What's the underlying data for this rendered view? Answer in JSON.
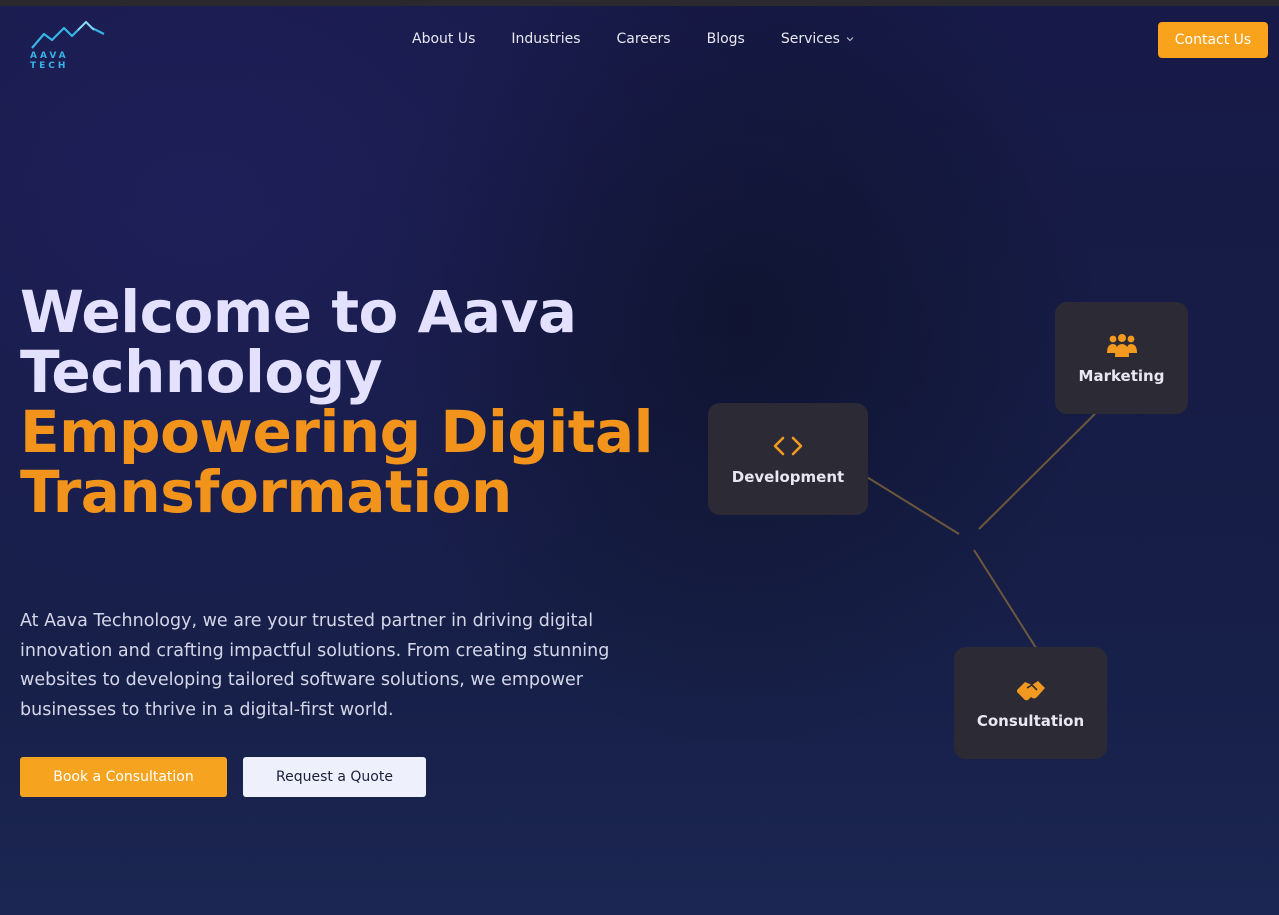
{
  "brand": {
    "logo_text": "AAVA TECH",
    "accent_color": "#f9a21b",
    "logo_color": "#37b4e6"
  },
  "nav": {
    "items": [
      {
        "label": "About Us"
      },
      {
        "label": "Industries"
      },
      {
        "label": "Careers"
      },
      {
        "label": "Blogs"
      },
      {
        "label": "Services",
        "icon": "chevron-down-icon"
      }
    ],
    "contact_label": "Contact Us"
  },
  "hero": {
    "title_line1": "Welcome to Aava Technology",
    "title_line2": "Empowering Digital Transformation",
    "description": "At Aava Technology, we are your trusted partner in driving digital innovation and crafting impactful solutions. From creating stunning websites to developing tailored software solutions, we empower businesses to thrive in a digital-first world.",
    "book_label": "Book a Consultation",
    "quote_label": "Request a Quote"
  },
  "cards": {
    "development": {
      "label": "Development",
      "icon": "code-icon"
    },
    "marketing": {
      "label": "Marketing",
      "icon": "people-icon"
    },
    "consultation": {
      "label": "Consultation",
      "icon": "handshake-icon"
    }
  }
}
